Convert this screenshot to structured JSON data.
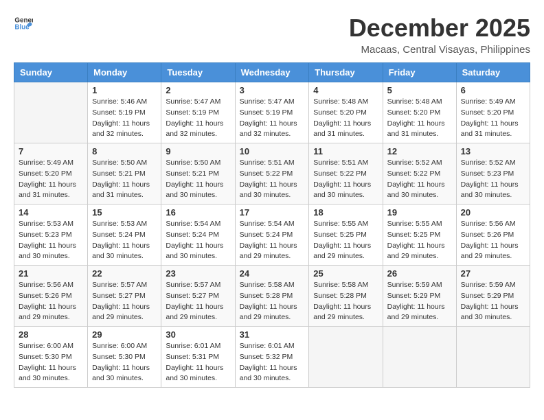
{
  "header": {
    "logo_general": "General",
    "logo_blue": "Blue",
    "month": "December 2025",
    "location": "Macaas, Central Visayas, Philippines"
  },
  "days_of_week": [
    "Sunday",
    "Monday",
    "Tuesday",
    "Wednesday",
    "Thursday",
    "Friday",
    "Saturday"
  ],
  "weeks": [
    [
      {
        "day": "",
        "sunrise": "",
        "sunset": "",
        "daylight": ""
      },
      {
        "day": "1",
        "sunrise": "Sunrise: 5:46 AM",
        "sunset": "Sunset: 5:19 PM",
        "daylight": "Daylight: 11 hours and 32 minutes."
      },
      {
        "day": "2",
        "sunrise": "Sunrise: 5:47 AM",
        "sunset": "Sunset: 5:19 PM",
        "daylight": "Daylight: 11 hours and 32 minutes."
      },
      {
        "day": "3",
        "sunrise": "Sunrise: 5:47 AM",
        "sunset": "Sunset: 5:19 PM",
        "daylight": "Daylight: 11 hours and 32 minutes."
      },
      {
        "day": "4",
        "sunrise": "Sunrise: 5:48 AM",
        "sunset": "Sunset: 5:20 PM",
        "daylight": "Daylight: 11 hours and 31 minutes."
      },
      {
        "day": "5",
        "sunrise": "Sunrise: 5:48 AM",
        "sunset": "Sunset: 5:20 PM",
        "daylight": "Daylight: 11 hours and 31 minutes."
      },
      {
        "day": "6",
        "sunrise": "Sunrise: 5:49 AM",
        "sunset": "Sunset: 5:20 PM",
        "daylight": "Daylight: 11 hours and 31 minutes."
      }
    ],
    [
      {
        "day": "7",
        "sunrise": "Sunrise: 5:49 AM",
        "sunset": "Sunset: 5:20 PM",
        "daylight": "Daylight: 11 hours and 31 minutes."
      },
      {
        "day": "8",
        "sunrise": "Sunrise: 5:50 AM",
        "sunset": "Sunset: 5:21 PM",
        "daylight": "Daylight: 11 hours and 31 minutes."
      },
      {
        "day": "9",
        "sunrise": "Sunrise: 5:50 AM",
        "sunset": "Sunset: 5:21 PM",
        "daylight": "Daylight: 11 hours and 30 minutes."
      },
      {
        "day": "10",
        "sunrise": "Sunrise: 5:51 AM",
        "sunset": "Sunset: 5:22 PM",
        "daylight": "Daylight: 11 hours and 30 minutes."
      },
      {
        "day": "11",
        "sunrise": "Sunrise: 5:51 AM",
        "sunset": "Sunset: 5:22 PM",
        "daylight": "Daylight: 11 hours and 30 minutes."
      },
      {
        "day": "12",
        "sunrise": "Sunrise: 5:52 AM",
        "sunset": "Sunset: 5:22 PM",
        "daylight": "Daylight: 11 hours and 30 minutes."
      },
      {
        "day": "13",
        "sunrise": "Sunrise: 5:52 AM",
        "sunset": "Sunset: 5:23 PM",
        "daylight": "Daylight: 11 hours and 30 minutes."
      }
    ],
    [
      {
        "day": "14",
        "sunrise": "Sunrise: 5:53 AM",
        "sunset": "Sunset: 5:23 PM",
        "daylight": "Daylight: 11 hours and 30 minutes."
      },
      {
        "day": "15",
        "sunrise": "Sunrise: 5:53 AM",
        "sunset": "Sunset: 5:24 PM",
        "daylight": "Daylight: 11 hours and 30 minutes."
      },
      {
        "day": "16",
        "sunrise": "Sunrise: 5:54 AM",
        "sunset": "Sunset: 5:24 PM",
        "daylight": "Daylight: 11 hours and 30 minutes."
      },
      {
        "day": "17",
        "sunrise": "Sunrise: 5:54 AM",
        "sunset": "Sunset: 5:24 PM",
        "daylight": "Daylight: 11 hours and 29 minutes."
      },
      {
        "day": "18",
        "sunrise": "Sunrise: 5:55 AM",
        "sunset": "Sunset: 5:25 PM",
        "daylight": "Daylight: 11 hours and 29 minutes."
      },
      {
        "day": "19",
        "sunrise": "Sunrise: 5:55 AM",
        "sunset": "Sunset: 5:25 PM",
        "daylight": "Daylight: 11 hours and 29 minutes."
      },
      {
        "day": "20",
        "sunrise": "Sunrise: 5:56 AM",
        "sunset": "Sunset: 5:26 PM",
        "daylight": "Daylight: 11 hours and 29 minutes."
      }
    ],
    [
      {
        "day": "21",
        "sunrise": "Sunrise: 5:56 AM",
        "sunset": "Sunset: 5:26 PM",
        "daylight": "Daylight: 11 hours and 29 minutes."
      },
      {
        "day": "22",
        "sunrise": "Sunrise: 5:57 AM",
        "sunset": "Sunset: 5:27 PM",
        "daylight": "Daylight: 11 hours and 29 minutes."
      },
      {
        "day": "23",
        "sunrise": "Sunrise: 5:57 AM",
        "sunset": "Sunset: 5:27 PM",
        "daylight": "Daylight: 11 hours and 29 minutes."
      },
      {
        "day": "24",
        "sunrise": "Sunrise: 5:58 AM",
        "sunset": "Sunset: 5:28 PM",
        "daylight": "Daylight: 11 hours and 29 minutes."
      },
      {
        "day": "25",
        "sunrise": "Sunrise: 5:58 AM",
        "sunset": "Sunset: 5:28 PM",
        "daylight": "Daylight: 11 hours and 29 minutes."
      },
      {
        "day": "26",
        "sunrise": "Sunrise: 5:59 AM",
        "sunset": "Sunset: 5:29 PM",
        "daylight": "Daylight: 11 hours and 29 minutes."
      },
      {
        "day": "27",
        "sunrise": "Sunrise: 5:59 AM",
        "sunset": "Sunset: 5:29 PM",
        "daylight": "Daylight: 11 hours and 30 minutes."
      }
    ],
    [
      {
        "day": "28",
        "sunrise": "Sunrise: 6:00 AM",
        "sunset": "Sunset: 5:30 PM",
        "daylight": "Daylight: 11 hours and 30 minutes."
      },
      {
        "day": "29",
        "sunrise": "Sunrise: 6:00 AM",
        "sunset": "Sunset: 5:30 PM",
        "daylight": "Daylight: 11 hours and 30 minutes."
      },
      {
        "day": "30",
        "sunrise": "Sunrise: 6:01 AM",
        "sunset": "Sunset: 5:31 PM",
        "daylight": "Daylight: 11 hours and 30 minutes."
      },
      {
        "day": "31",
        "sunrise": "Sunrise: 6:01 AM",
        "sunset": "Sunset: 5:32 PM",
        "daylight": "Daylight: 11 hours and 30 minutes."
      },
      {
        "day": "",
        "sunrise": "",
        "sunset": "",
        "daylight": ""
      },
      {
        "day": "",
        "sunrise": "",
        "sunset": "",
        "daylight": ""
      },
      {
        "day": "",
        "sunrise": "",
        "sunset": "",
        "daylight": ""
      }
    ]
  ]
}
